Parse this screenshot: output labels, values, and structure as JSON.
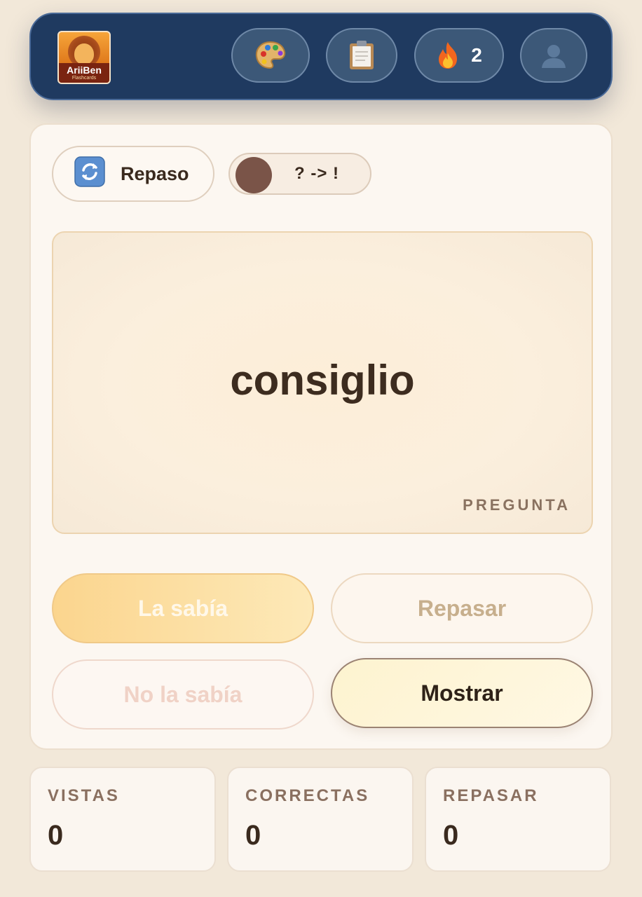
{
  "header": {
    "logo_brand": "AriiBen",
    "logo_sub": "Flashcards",
    "streak_count": "2",
    "icons": [
      "palette-icon",
      "clipboard-icon",
      "fire-icon",
      "user-icon"
    ]
  },
  "controls": {
    "mode_label": "Repaso",
    "toggle_label": "? -> !"
  },
  "card": {
    "word": "consiglio",
    "side_label": "PREGUNTA"
  },
  "actions": {
    "knew": "La sabía",
    "review": "Repasar",
    "didnt_know": "No la sabía",
    "show": "Mostrar"
  },
  "stats": [
    {
      "label": "VISTAS",
      "value": "0"
    },
    {
      "label": "CORRECTAS",
      "value": "0"
    },
    {
      "label": "REPASAR",
      "value": "0"
    }
  ],
  "colors": {
    "header_bg": "#1f3a60",
    "background": "#f2e8d9",
    "text_dark": "#3a2a1e",
    "knew_accent": "#fbd58e"
  }
}
